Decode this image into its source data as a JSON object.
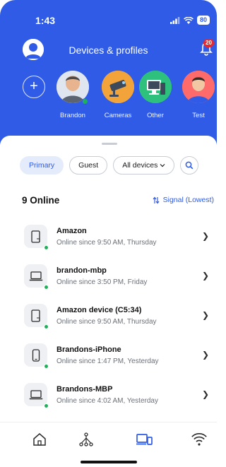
{
  "status_bar": {
    "time": "1:43",
    "battery": "80"
  },
  "header": {
    "title": "Devices & profiles",
    "notification_count": "20"
  },
  "profiles": [
    {
      "label": "Brandon",
      "color": "#dfe6f0",
      "online": true
    },
    {
      "label": "Cameras",
      "color": "#f2a43a"
    },
    {
      "label": "Other",
      "color": "#2ec07d"
    },
    {
      "label": "Test",
      "color": "#ff6b6b"
    }
  ],
  "filters": {
    "primary": "Primary",
    "guest": "Guest",
    "all_devices": "All devices"
  },
  "list_header": {
    "online_count": "9 Online",
    "sort_label": "Signal (Lowest)"
  },
  "devices": [
    {
      "name": "Amazon",
      "status": "Online since 9:50 AM, Thursday",
      "icon": "tablet-icon"
    },
    {
      "name": "brandon-mbp",
      "status": "Online since 3:50 PM, Friday",
      "icon": "laptop-icon"
    },
    {
      "name": "Amazon device (C5:34)",
      "status": "Online since 9:50 AM, Thursday",
      "icon": "tablet-icon"
    },
    {
      "name": "Brandons-iPhone",
      "status": "Online since 1:47 PM, Yesterday",
      "icon": "phone-icon"
    },
    {
      "name": "Brandons-MBP",
      "status": "Online since 4:02 AM, Yesterday",
      "icon": "laptop-icon"
    }
  ],
  "tabbar": {
    "tabs": [
      "home-icon",
      "network-icon",
      "devices-icon",
      "wifi-icon"
    ],
    "active_tab": "devices-icon"
  },
  "colors": {
    "accent": "#2f5be6",
    "online": "#1fb15a",
    "badge": "#e5292d"
  }
}
